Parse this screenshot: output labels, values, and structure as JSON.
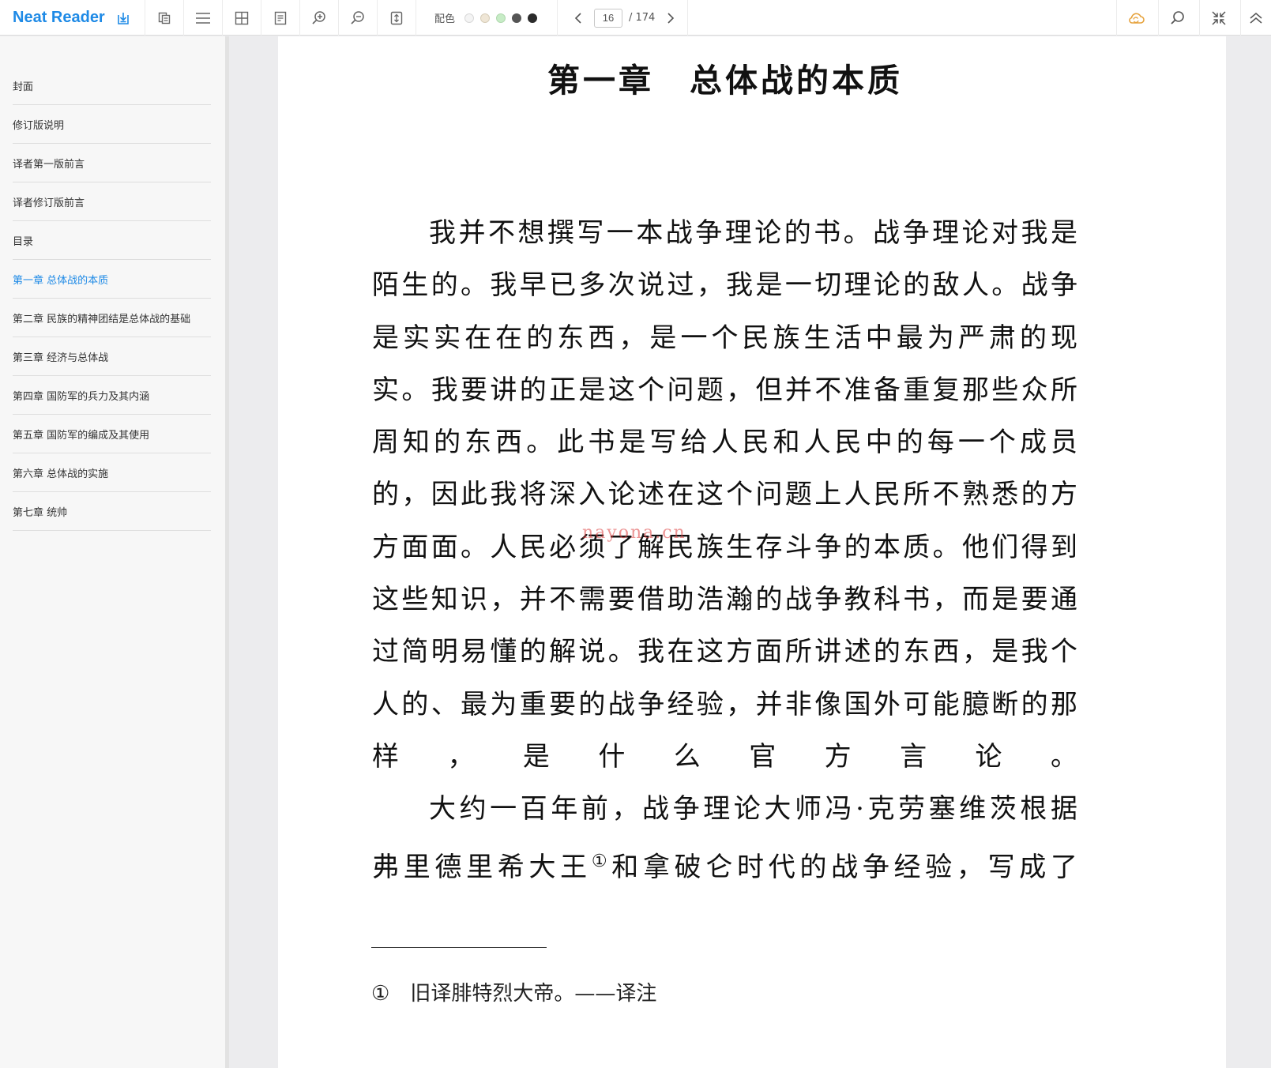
{
  "app": {
    "name": "Neat Reader"
  },
  "toolbar": {
    "theme_label": "配色",
    "theme_colors": [
      "#f4f4f4",
      "#efe6d6",
      "#c7ecc6",
      "#555555",
      "#2b2b2b"
    ],
    "current_page": "16",
    "total_pages": "/ 174",
    "accent_color": "#1e8ae6",
    "icons": [
      "save-to-library-icon",
      "copy-icon",
      "toc-menu-icon",
      "grid-icon",
      "notes-icon",
      "zoom-in-icon",
      "zoom-out-icon",
      "fit-height-icon",
      "prev-page-icon",
      "next-page-icon",
      "cloud-sync-icon",
      "search-icon",
      "collapse-icon",
      "scroll-top-icon"
    ]
  },
  "sidebar": {
    "items": [
      {
        "label": "封面"
      },
      {
        "label": "修订版说明"
      },
      {
        "label": "译者第一版前言"
      },
      {
        "label": "译者修订版前言"
      },
      {
        "label": "目录"
      },
      {
        "label": "第一章 总体战的本质"
      },
      {
        "label": "第二章 民族的精神团结是总体战的基础"
      },
      {
        "label": "第三章 经济与总体战"
      },
      {
        "label": "第四章 国防军的兵力及其内涵"
      },
      {
        "label": "第五章 国防军的编成及其使用"
      },
      {
        "label": "第六章 总体战的实施"
      },
      {
        "label": "第七章 统帅"
      }
    ],
    "active_index": 5
  },
  "page": {
    "chapter_title": "第一章　总体战的本质",
    "lines": [
      "我并不想撰写一本战争理论的书。战争理论对我是",
      "陌生的。我早已多次说过，我是一切理论的敌人。战争",
      "是实实在在的东西，是一个民族生活中最为严肃的现",
      "实。我要讲的正是这个问题，但并不准备重复那些众所",
      "周知的东西。此书是写给人民和人民中的每一个成员",
      "的，因此我将深入论述在这个问题上人民所不熟悉的方",
      "方面面。人民必须了解民族生存斗争的本质。他们得到",
      "这些知识，并不需要借助浩瀚的战争教科书，而是要通",
      "过简明易懂的解说。我在这方面所讲述的东西，是我个",
      "人的、最为重要的战争经验，并非像国外可能臆断的那",
      "样，是什么官方言论。",
      "大约一百年前，战争理论大师冯·克劳塞维茨根据",
      "弗里德里希大王",
      "和拿破仑时代的战争经验，写成了"
    ],
    "footnote_ref": "①",
    "footnote_mark": "①",
    "footnote_text": "旧译腓特烈大帝。——译注",
    "watermark": "nayona.cn"
  }
}
